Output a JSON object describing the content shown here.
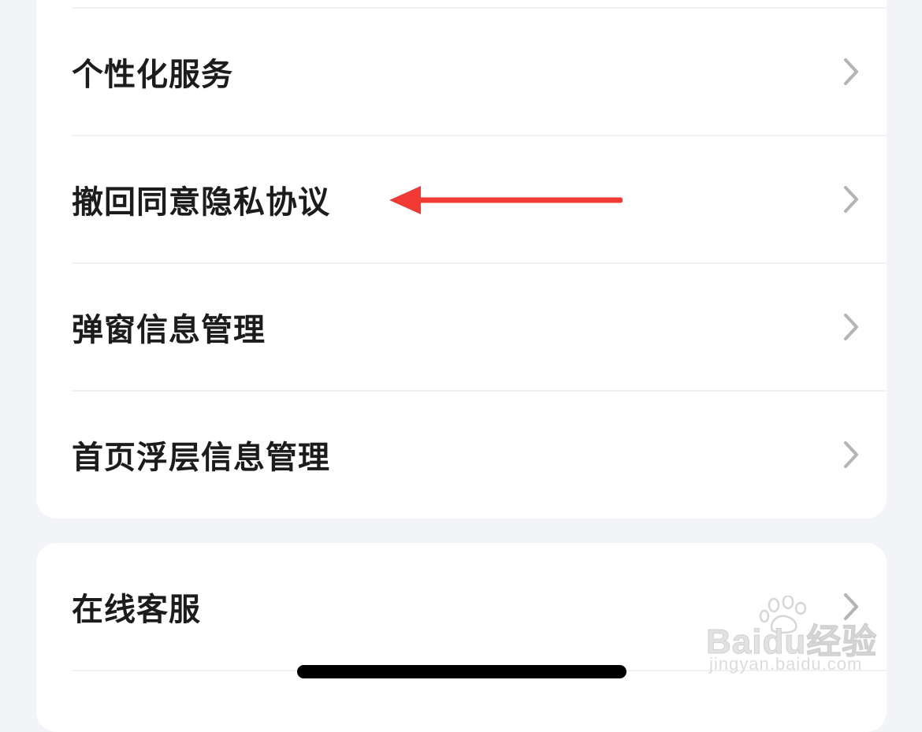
{
  "settings_group_1": {
    "items": [
      {
        "label": "个性化服务"
      },
      {
        "label": "撤回同意隐私协议"
      },
      {
        "label": "弹窗信息管理"
      },
      {
        "label": "首页浮层信息管理"
      }
    ]
  },
  "settings_group_2": {
    "items": [
      {
        "label": "在线客服"
      }
    ]
  },
  "annotation": {
    "arrow_color": "#f03a33"
  },
  "icons": {
    "row_chevron": "chevron-right-icon"
  },
  "watermark": {
    "brand": "Baidu经验",
    "url": "jingyan.baidu.com"
  },
  "colors": {
    "background": "#f2f4f8",
    "card": "#ffffff",
    "text": "#1c1c1e",
    "chevron": "#b3b3b8",
    "divider": "#f0f1f4"
  }
}
